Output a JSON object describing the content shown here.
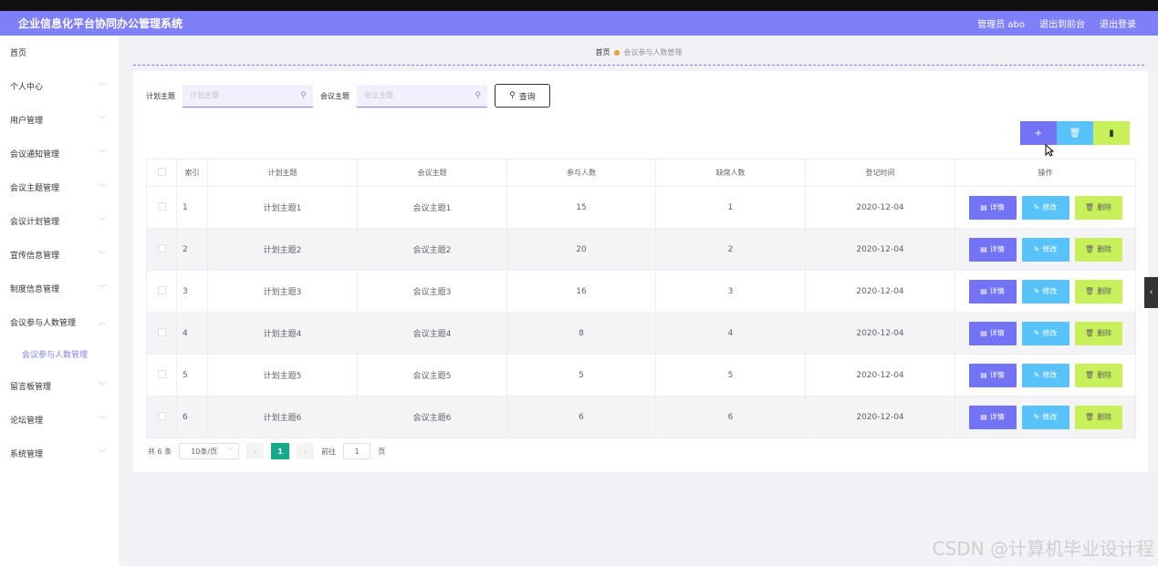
{
  "header": {
    "title": "企业信息化平台协同办公管理系统",
    "admin": "管理员 abo",
    "to_front": "退出到前台",
    "logout": "退出登录"
  },
  "sidebar": {
    "items": [
      {
        "label": "首页"
      },
      {
        "label": "个人中心"
      },
      {
        "label": "用户管理"
      },
      {
        "label": "会议通知管理"
      },
      {
        "label": "会议主题管理"
      },
      {
        "label": "会议计划管理"
      },
      {
        "label": "宣传信息管理"
      },
      {
        "label": "制度信息管理"
      },
      {
        "label": "会议参与人数管理"
      },
      {
        "label": "留言板管理"
      },
      {
        "label": "论坛管理"
      },
      {
        "label": "系统管理"
      }
    ],
    "active_sub": "会议参与人数管理"
  },
  "breadcrumb": {
    "home": "首页",
    "current": "会议参与人数管理"
  },
  "search": {
    "plan_label": "计划主题",
    "plan_placeholder": "计划主题",
    "meeting_label": "会议主题",
    "meeting_placeholder": "会议主题",
    "query_button": "查询"
  },
  "table": {
    "headers": [
      "索引",
      "计划主题",
      "会议主题",
      "参与人数",
      "缺席人数",
      "登记时间",
      "操作"
    ],
    "rows": [
      {
        "index": "1",
        "plan": "计划主题1",
        "meeting": "会议主题1",
        "attend": "15",
        "absent": "1",
        "date": "2020-12-04"
      },
      {
        "index": "2",
        "plan": "计划主题2",
        "meeting": "会议主题2",
        "attend": "20",
        "absent": "2",
        "date": "2020-12-04"
      },
      {
        "index": "3",
        "plan": "计划主题3",
        "meeting": "会议主题3",
        "attend": "16",
        "absent": "3",
        "date": "2020-12-04"
      },
      {
        "index": "4",
        "plan": "计划主题4",
        "meeting": "会议主题4",
        "attend": "8",
        "absent": "4",
        "date": "2020-12-04"
      },
      {
        "index": "5",
        "plan": "计划主题5",
        "meeting": "会议主题5",
        "attend": "5",
        "absent": "5",
        "date": "2020-12-04"
      },
      {
        "index": "6",
        "plan": "计划主题6",
        "meeting": "会议主题6",
        "attend": "6",
        "absent": "6",
        "date": "2020-12-04"
      }
    ],
    "actions": {
      "detail": "详情",
      "edit": "修改",
      "delete": "删除"
    }
  },
  "pagination": {
    "total": "共 6 条",
    "page_size": "10条/页",
    "current_page": "1",
    "goto_label": "前往",
    "goto_value": "1",
    "page_unit": "页"
  },
  "watermark": "CSDN @计算机毕业设计程",
  "colors": {
    "header": "#7f7ff8",
    "add_button": "#7373f5",
    "delete_all_button": "#58c2fa",
    "chart_button": "#c8f05a",
    "active_page": "#18a88a"
  }
}
